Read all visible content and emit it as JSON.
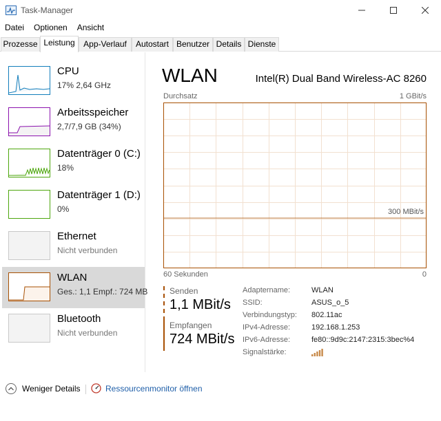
{
  "window": {
    "title": "Task-Manager"
  },
  "menu": [
    "Datei",
    "Optionen",
    "Ansicht"
  ],
  "tabs": [
    "Prozesse",
    "Leistung",
    "App-Verlauf",
    "Autostart",
    "Benutzer",
    "Details",
    "Dienste"
  ],
  "active_tab": "Leistung",
  "resources": [
    {
      "name": "CPU",
      "sub": "17% 2,64 GHz",
      "color": "#117dbb"
    },
    {
      "name": "Arbeitsspeicher",
      "sub": "2,7/7,9 GB (34%)",
      "color": "#8b12ae"
    },
    {
      "name": "Datenträger 0 (C:)",
      "sub": "18%",
      "color": "#4da60c"
    },
    {
      "name": "Datenträger 1 (D:)",
      "sub": "0%",
      "color": "#4da60c"
    },
    {
      "name": "Ethernet",
      "sub": "Nicht verbunden",
      "color": "#a7a7a7"
    },
    {
      "name": "WLAN",
      "sub": "Ges.: 1,1 Empf.: 724 MB",
      "color": "#a74f01"
    },
    {
      "name": "Bluetooth",
      "sub": "Nicht verbunden",
      "color": "#a7a7a7"
    }
  ],
  "selected_resource": "WLAN",
  "detail": {
    "title": "WLAN",
    "adapter": "Intel(R) Dual Band Wireless-AC 8260",
    "chart_title": "Durchsatz",
    "chart_max": "1 GBit/s",
    "chart_mid": "300 MBit/s",
    "x_left": "60 Sekunden",
    "x_right": "0",
    "send_label": "Senden",
    "send_value": "1,1 MBit/s",
    "recv_label": "Empfangen",
    "recv_value": "724 MBit/s",
    "properties": [
      {
        "key": "Adaptername:",
        "value": "WLAN"
      },
      {
        "key": "SSID:",
        "value": "ASUS_o_5"
      },
      {
        "key": "Verbindungstyp:",
        "value": "802.11ac"
      },
      {
        "key": "IPv4-Adresse:",
        "value": "192.168.1.253"
      },
      {
        "key": "IPv6-Adresse:",
        "value": "fe80::9d9c:2147:2315:3bec%4"
      },
      {
        "key": "Signalstärke:",
        "value": ""
      }
    ],
    "signal_bars": 5
  },
  "bottom": {
    "fewer_details": "Weniger Details",
    "resource_monitor": "Ressourcenmonitor öffnen"
  },
  "colors": {
    "wlan_line": "#a74f01",
    "wlan_fill": "#fcf3eb",
    "grid": "#f2e0d0",
    "send_dash": "#a74f01"
  },
  "chart_data": {
    "type": "area",
    "title": "Durchsatz",
    "ylabel": "",
    "xlabel": "60 Sekunden",
    "ylim": [
      0,
      1000
    ],
    "unit": "MBit/s",
    "x": [
      60,
      59,
      58,
      57,
      56,
      55,
      54,
      53,
      52,
      51,
      50,
      49,
      48,
      47,
      46,
      45,
      44,
      43,
      42,
      41,
      40,
      39,
      38,
      37,
      36,
      35,
      34,
      33,
      32,
      31,
      30,
      29,
      28,
      27,
      26,
      25,
      24,
      23,
      22,
      21,
      20,
      19,
      18,
      17,
      16,
      15,
      14,
      13,
      12,
      11,
      10,
      9,
      8,
      7,
      6,
      5,
      4,
      3,
      2,
      1,
      0
    ],
    "series": [
      {
        "values": [
          0,
          0,
          0,
          0,
          0,
          0,
          0,
          0,
          0,
          0,
          0,
          0,
          0,
          0,
          0,
          0,
          0,
          0,
          0,
          0,
          0,
          0,
          0,
          0,
          0,
          0,
          0,
          0,
          0,
          0,
          0,
          0,
          0,
          0,
          0,
          0,
          0,
          0,
          0,
          0,
          0,
          0,
          0,
          0,
          0,
          0,
          0,
          0,
          0,
          0,
          0,
          0,
          0,
          0,
          0,
          0,
          0,
          0,
          0,
          0,
          0
        ]
      }
    ]
  }
}
